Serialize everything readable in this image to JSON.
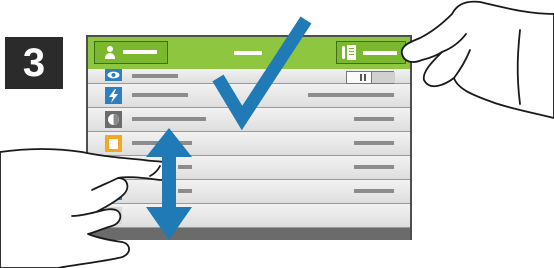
{
  "step": {
    "number": "3"
  },
  "icons": {
    "user": "user-icon",
    "contact": "address-book-icon",
    "eye": "eye-icon",
    "flash": "lightning-icon",
    "contrast": "half-circle-icon",
    "frame": "square-frame-icon",
    "resize": "resize-arrows-icon",
    "grid": "grid-icon",
    "checkmark": "checkmark-icon",
    "scroll": "vertical-double-arrow-icon"
  },
  "colors": {
    "header_green": "#8ec63f",
    "button_green": "#7cb82f",
    "checkmark_blue": "#1f7ab5",
    "icon_blue": "#2e7fc1",
    "icon_orange": "#f7a823",
    "badge_dark": "#2b2b2b"
  }
}
